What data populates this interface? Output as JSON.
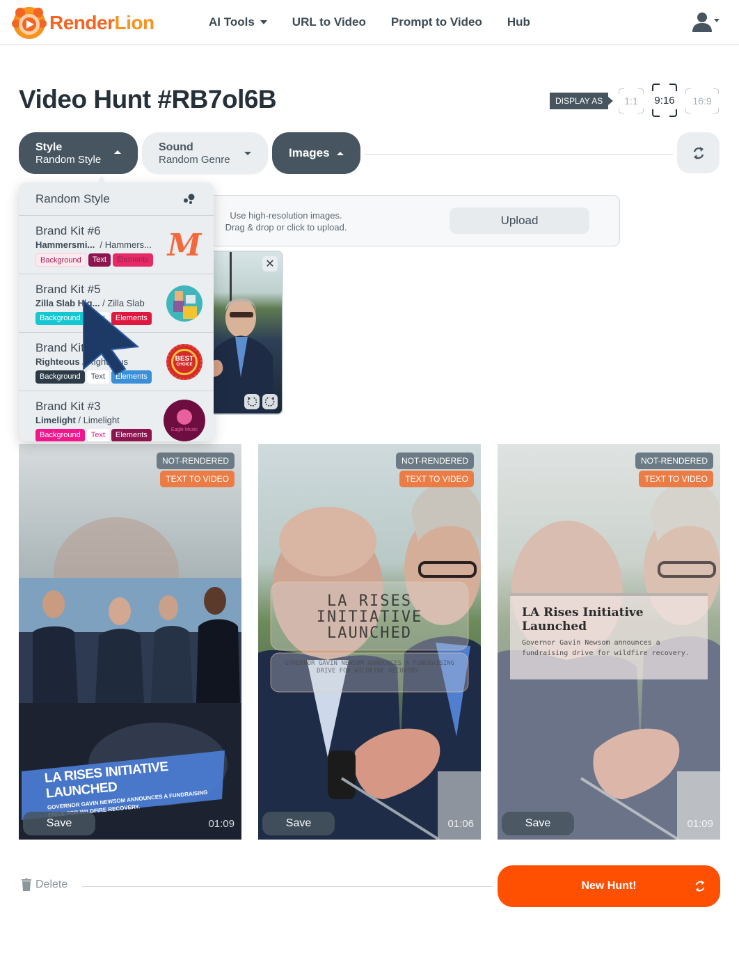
{
  "brand": {
    "name_part1": "Render",
    "name_part2": "Lion"
  },
  "nav": {
    "items": [
      {
        "label": "AI Tools",
        "has_dropdown": true
      },
      {
        "label": "URL to Video"
      },
      {
        "label": "Prompt to Video"
      },
      {
        "label": "Hub"
      }
    ],
    "user_icon": "user-icon"
  },
  "page": {
    "title": "Video Hunt #RB7ol6B"
  },
  "display_as": {
    "label": "DISPLAY AS",
    "options": [
      "1:1",
      "9:16",
      "16:9"
    ],
    "selected": "9:16"
  },
  "options": {
    "style": {
      "label": "Style",
      "value": "Random Style",
      "open": true
    },
    "sound": {
      "label": "Sound",
      "value": "Random Genre",
      "open": false
    },
    "images": {
      "label": "Images",
      "open": true
    }
  },
  "style_dropdown": {
    "random_label": "Random Style",
    "kits": [
      {
        "title": "Brand Kit #6",
        "font_primary": "Hammersmi...",
        "font_secondary": "/ Hammers...",
        "tags": [
          {
            "label": "Background",
            "bg": "#fde8ee",
            "fg": "#9b1f55"
          },
          {
            "label": "Text",
            "bg": "#8c1550",
            "fg": "#ffffff"
          },
          {
            "label": "Elements",
            "bg": "#e62a66",
            "fg": "#9b1f55"
          }
        ],
        "logo": "m-script-logo"
      },
      {
        "title": "Brand Kit #5",
        "font_primary": "Zilla Slab Hig...",
        "font_secondary": "/ Zilla Slab",
        "tags": [
          {
            "label": "Background",
            "bg": "#14c8d2",
            "fg": "#ffffff"
          },
          {
            "label": "Text",
            "bg": "#ffffff",
            "fg": "#14c8d2"
          },
          {
            "label": "Elements",
            "bg": "#e0173f",
            "fg": "#ffffff"
          }
        ],
        "logo": "office-worker-logo"
      },
      {
        "title": "Brand Kit #4",
        "font_primary": "Righteous",
        "font_secondary": "/ Righteous",
        "tags": [
          {
            "label": "Background",
            "bg": "#2c3a47",
            "fg": "#ffffff"
          },
          {
            "label": "Text",
            "bg": "#ffffff",
            "fg": "#3c4a55"
          },
          {
            "label": "Elements",
            "bg": "#3a8fd9",
            "fg": "#ffffff"
          }
        ],
        "logo": "best-choice-badge-logo"
      },
      {
        "title": "Brand Kit #3",
        "font_primary": "Limelight",
        "font_secondary": "/ Limelight",
        "tags": [
          {
            "label": "Background",
            "bg": "#f0168c",
            "fg": "#ffffff"
          },
          {
            "label": "Text",
            "bg": "#ffffff",
            "fg": "#f0168c"
          },
          {
            "label": "Elements",
            "bg": "#8c1550",
            "fg": "#ffffff"
          }
        ],
        "logo": "eagle-music-logo"
      }
    ],
    "best_choice_text": [
      "BEST",
      "CHOICE"
    ],
    "eagle_text": "Eagle Music"
  },
  "upload": {
    "hint_line1": "Use high-resolution images.",
    "hint_line2": "Drag & drop or click to upload.",
    "button_label": "Upload"
  },
  "videos": [
    {
      "status": "NOT-RENDERED",
      "type": "TEXT TO VIDEO",
      "save_label": "Save",
      "duration": "01:09",
      "headline": "LA RISES INITIATIVE LAUNCHED",
      "subtext": "GOVERNOR GAVIN NEWSOM ANNOUNCES A FUNDRAISING DRIVE FOR WILDFIRE RECOVERY."
    },
    {
      "status": "NOT-RENDERED",
      "type": "TEXT TO VIDEO",
      "save_label": "Save",
      "duration": "01:06",
      "headline": "LA RISES INITIATIVE LAUNCHED",
      "subtext": "GOVERNOR GAVIN NEWSOM ANNOUNCES A FUNDRAISING DRIVE FOR WILDFIRE RECOVERY."
    },
    {
      "status": "NOT-RENDERED",
      "type": "TEXT TO VIDEO",
      "save_label": "Save",
      "duration": "01:09",
      "headline": "LA Rises Initiative Launched",
      "subtext": "Governor Gavin Newsom announces a fundraising drive for wildfire recovery."
    }
  ],
  "footer": {
    "delete_label": "Delete",
    "new_hunt_label": "New Hunt!"
  },
  "colors": {
    "brand_orange": "#fe5000",
    "slate": "#46555f",
    "badge_orange": "#ec7c45"
  }
}
